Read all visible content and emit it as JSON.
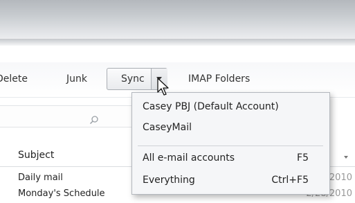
{
  "toolbar": {
    "delete_label": "Delete",
    "junk_label": "Junk",
    "sync_label": "Sync",
    "imap_label": "IMAP Folders"
  },
  "sync_menu": {
    "items": [
      {
        "label": "Casey PBJ (Default Account)",
        "shortcut": ""
      },
      {
        "label": "CaseyMail",
        "shortcut": ""
      },
      {
        "label": "All e-mail accounts",
        "shortcut": "F5"
      },
      {
        "label": "Everything",
        "shortcut": "Ctrl+F5"
      }
    ]
  },
  "message_list": {
    "subject_header": "Subject",
    "rows": [
      {
        "subject": "Daily mail",
        "date": "2010"
      },
      {
        "subject": "Monday's Schedule",
        "date": "2/28/2010"
      }
    ]
  },
  "icons": {
    "search": "search-icon",
    "dropdown_arrow": "chevron-down-icon",
    "cursor": "mouse-pointer-icon"
  },
  "colors": {
    "menu_background": "#f5f6f8",
    "button_border": "#a9adb3"
  }
}
